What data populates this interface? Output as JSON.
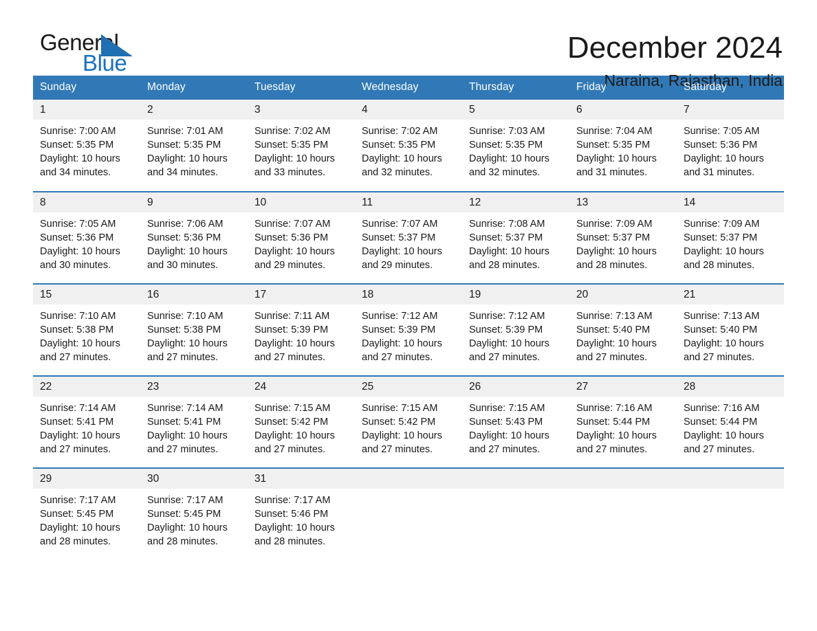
{
  "brand": {
    "name_part1": "General",
    "name_part2": "Blue",
    "logo_icon": "triangle-logo"
  },
  "header": {
    "title": "December 2024",
    "location": "Naraina, Rajasthan, India"
  },
  "colors": {
    "header_blue": "#3179b6",
    "brand_blue": "#1a72bb",
    "daynum_band": "#f0f0f0",
    "text": "#1a1a1a"
  },
  "weekdays": [
    "Sunday",
    "Monday",
    "Tuesday",
    "Wednesday",
    "Thursday",
    "Friday",
    "Saturday"
  ],
  "weeks": [
    [
      {
        "day": "1",
        "sunrise": "Sunrise: 7:00 AM",
        "sunset": "Sunset: 5:35 PM",
        "daylight": "Daylight: 10 hours and 34 minutes."
      },
      {
        "day": "2",
        "sunrise": "Sunrise: 7:01 AM",
        "sunset": "Sunset: 5:35 PM",
        "daylight": "Daylight: 10 hours and 34 minutes."
      },
      {
        "day": "3",
        "sunrise": "Sunrise: 7:02 AM",
        "sunset": "Sunset: 5:35 PM",
        "daylight": "Daylight: 10 hours and 33 minutes."
      },
      {
        "day": "4",
        "sunrise": "Sunrise: 7:02 AM",
        "sunset": "Sunset: 5:35 PM",
        "daylight": "Daylight: 10 hours and 32 minutes."
      },
      {
        "day": "5",
        "sunrise": "Sunrise: 7:03 AM",
        "sunset": "Sunset: 5:35 PM",
        "daylight": "Daylight: 10 hours and 32 minutes."
      },
      {
        "day": "6",
        "sunrise": "Sunrise: 7:04 AM",
        "sunset": "Sunset: 5:35 PM",
        "daylight": "Daylight: 10 hours and 31 minutes."
      },
      {
        "day": "7",
        "sunrise": "Sunrise: 7:05 AM",
        "sunset": "Sunset: 5:36 PM",
        "daylight": "Daylight: 10 hours and 31 minutes."
      }
    ],
    [
      {
        "day": "8",
        "sunrise": "Sunrise: 7:05 AM",
        "sunset": "Sunset: 5:36 PM",
        "daylight": "Daylight: 10 hours and 30 minutes."
      },
      {
        "day": "9",
        "sunrise": "Sunrise: 7:06 AM",
        "sunset": "Sunset: 5:36 PM",
        "daylight": "Daylight: 10 hours and 30 minutes."
      },
      {
        "day": "10",
        "sunrise": "Sunrise: 7:07 AM",
        "sunset": "Sunset: 5:36 PM",
        "daylight": "Daylight: 10 hours and 29 minutes."
      },
      {
        "day": "11",
        "sunrise": "Sunrise: 7:07 AM",
        "sunset": "Sunset: 5:37 PM",
        "daylight": "Daylight: 10 hours and 29 minutes."
      },
      {
        "day": "12",
        "sunrise": "Sunrise: 7:08 AM",
        "sunset": "Sunset: 5:37 PM",
        "daylight": "Daylight: 10 hours and 28 minutes."
      },
      {
        "day": "13",
        "sunrise": "Sunrise: 7:09 AM",
        "sunset": "Sunset: 5:37 PM",
        "daylight": "Daylight: 10 hours and 28 minutes."
      },
      {
        "day": "14",
        "sunrise": "Sunrise: 7:09 AM",
        "sunset": "Sunset: 5:37 PM",
        "daylight": "Daylight: 10 hours and 28 minutes."
      }
    ],
    [
      {
        "day": "15",
        "sunrise": "Sunrise: 7:10 AM",
        "sunset": "Sunset: 5:38 PM",
        "daylight": "Daylight: 10 hours and 27 minutes."
      },
      {
        "day": "16",
        "sunrise": "Sunrise: 7:10 AM",
        "sunset": "Sunset: 5:38 PM",
        "daylight": "Daylight: 10 hours and 27 minutes."
      },
      {
        "day": "17",
        "sunrise": "Sunrise: 7:11 AM",
        "sunset": "Sunset: 5:39 PM",
        "daylight": "Daylight: 10 hours and 27 minutes."
      },
      {
        "day": "18",
        "sunrise": "Sunrise: 7:12 AM",
        "sunset": "Sunset: 5:39 PM",
        "daylight": "Daylight: 10 hours and 27 minutes."
      },
      {
        "day": "19",
        "sunrise": "Sunrise: 7:12 AM",
        "sunset": "Sunset: 5:39 PM",
        "daylight": "Daylight: 10 hours and 27 minutes."
      },
      {
        "day": "20",
        "sunrise": "Sunrise: 7:13 AM",
        "sunset": "Sunset: 5:40 PM",
        "daylight": "Daylight: 10 hours and 27 minutes."
      },
      {
        "day": "21",
        "sunrise": "Sunrise: 7:13 AM",
        "sunset": "Sunset: 5:40 PM",
        "daylight": "Daylight: 10 hours and 27 minutes."
      }
    ],
    [
      {
        "day": "22",
        "sunrise": "Sunrise: 7:14 AM",
        "sunset": "Sunset: 5:41 PM",
        "daylight": "Daylight: 10 hours and 27 minutes."
      },
      {
        "day": "23",
        "sunrise": "Sunrise: 7:14 AM",
        "sunset": "Sunset: 5:41 PM",
        "daylight": "Daylight: 10 hours and 27 minutes."
      },
      {
        "day": "24",
        "sunrise": "Sunrise: 7:15 AM",
        "sunset": "Sunset: 5:42 PM",
        "daylight": "Daylight: 10 hours and 27 minutes."
      },
      {
        "day": "25",
        "sunrise": "Sunrise: 7:15 AM",
        "sunset": "Sunset: 5:42 PM",
        "daylight": "Daylight: 10 hours and 27 minutes."
      },
      {
        "day": "26",
        "sunrise": "Sunrise: 7:15 AM",
        "sunset": "Sunset: 5:43 PM",
        "daylight": "Daylight: 10 hours and 27 minutes."
      },
      {
        "day": "27",
        "sunrise": "Sunrise: 7:16 AM",
        "sunset": "Sunset: 5:44 PM",
        "daylight": "Daylight: 10 hours and 27 minutes."
      },
      {
        "day": "28",
        "sunrise": "Sunrise: 7:16 AM",
        "sunset": "Sunset: 5:44 PM",
        "daylight": "Daylight: 10 hours and 27 minutes."
      }
    ],
    [
      {
        "day": "29",
        "sunrise": "Sunrise: 7:17 AM",
        "sunset": "Sunset: 5:45 PM",
        "daylight": "Daylight: 10 hours and 28 minutes."
      },
      {
        "day": "30",
        "sunrise": "Sunrise: 7:17 AM",
        "sunset": "Sunset: 5:45 PM",
        "daylight": "Daylight: 10 hours and 28 minutes."
      },
      {
        "day": "31",
        "sunrise": "Sunrise: 7:17 AM",
        "sunset": "Sunset: 5:46 PM",
        "daylight": "Daylight: 10 hours and 28 minutes."
      },
      {
        "day": "",
        "sunrise": "",
        "sunset": "",
        "daylight": ""
      },
      {
        "day": "",
        "sunrise": "",
        "sunset": "",
        "daylight": ""
      },
      {
        "day": "",
        "sunrise": "",
        "sunset": "",
        "daylight": ""
      },
      {
        "day": "",
        "sunrise": "",
        "sunset": "",
        "daylight": ""
      }
    ]
  ]
}
